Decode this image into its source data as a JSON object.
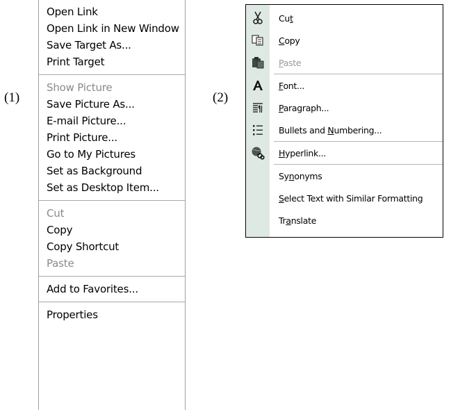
{
  "labels": {
    "one": "(1)",
    "two": "(2)"
  },
  "menu1": {
    "groups": [
      [
        {
          "label": "Open Link",
          "disabled": false
        },
        {
          "label": "Open Link in New Window",
          "disabled": false
        },
        {
          "label": "Save Target As...",
          "disabled": false
        },
        {
          "label": "Print Target",
          "disabled": false
        }
      ],
      [
        {
          "label": "Show Picture",
          "disabled": true
        },
        {
          "label": "Save Picture As...",
          "disabled": false
        },
        {
          "label": "E-mail Picture...",
          "disabled": false
        },
        {
          "label": "Print Picture...",
          "disabled": false
        },
        {
          "label": "Go to My Pictures",
          "disabled": false
        },
        {
          "label": "Set as Background",
          "disabled": false
        },
        {
          "label": "Set as Desktop Item...",
          "disabled": false
        }
      ],
      [
        {
          "label": "Cut",
          "disabled": true
        },
        {
          "label": "Copy",
          "disabled": false
        },
        {
          "label": "Copy Shortcut",
          "disabled": false
        },
        {
          "label": "Paste",
          "disabled": true
        }
      ],
      [
        {
          "label": "Add to Favorites...",
          "disabled": false
        }
      ],
      [
        {
          "label": "Properties",
          "disabled": false
        }
      ]
    ]
  },
  "menu2": {
    "items": [
      {
        "pre": "Cu",
        "key": "t",
        "post": "",
        "icon": "scissors-icon",
        "disabled": false
      },
      {
        "pre": "",
        "key": "C",
        "post": "opy",
        "icon": "copy-icon",
        "disabled": false
      },
      {
        "pre": "",
        "key": "P",
        "post": "aste",
        "icon": "paste-icon",
        "disabled": true
      },
      {
        "pre": "",
        "key": "F",
        "post": "ont...",
        "icon": "font-icon",
        "disabled": false
      },
      {
        "pre": "",
        "key": "P",
        "post": "aragraph...",
        "icon": "paragraph-icon",
        "disabled": false
      },
      {
        "pre": "Bullets and ",
        "key": "N",
        "post": "umbering...",
        "icon": "bullets-icon",
        "disabled": false
      },
      {
        "pre": "",
        "key": "H",
        "post": "yperlink...",
        "icon": "hyperlink-icon",
        "disabled": false
      },
      {
        "pre": "Sy",
        "key": "n",
        "post": "onyms",
        "icon": "",
        "disabled": false
      },
      {
        "pre": "",
        "key": "S",
        "post": "elect Text with Similar Formatting",
        "icon": "",
        "disabled": false
      },
      {
        "pre": "Tr",
        "key": "a",
        "post": "nslate",
        "icon": "",
        "disabled": false
      }
    ]
  }
}
